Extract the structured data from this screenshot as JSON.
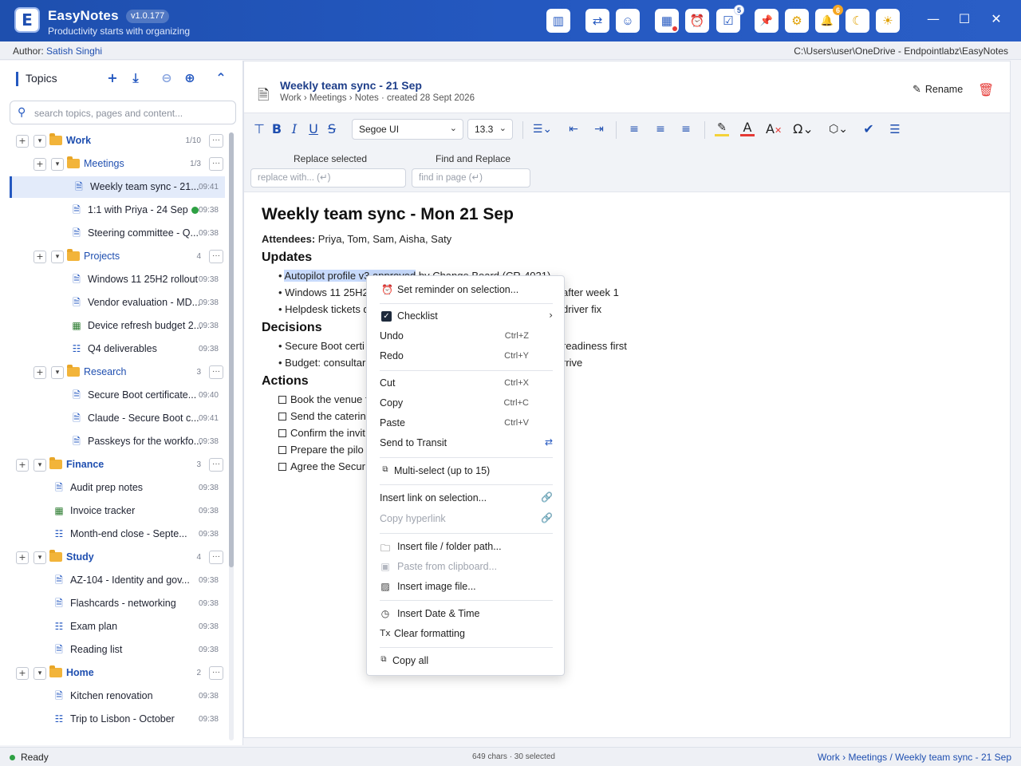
{
  "app": {
    "name": "EasyNotes",
    "version": "v1.0.177",
    "tagline": "Productivity starts with organizing",
    "logo_letter": "E"
  },
  "titlebar_tools": [
    {
      "name": "dashboard-icon",
      "glyph": "▥"
    },
    {
      "name": "transit-icon",
      "glyph": "⇄"
    },
    {
      "name": "robot-icon",
      "glyph": "☺"
    },
    {
      "name": "calendar-icon",
      "glyph": "▦"
    },
    {
      "name": "alarm-clock-icon",
      "glyph": "⏰"
    },
    {
      "name": "tasks-icon",
      "glyph": "☑",
      "badge": "5"
    },
    {
      "name": "pin-icon",
      "glyph": "📌"
    },
    {
      "name": "gear-icon",
      "glyph": "⚙"
    },
    {
      "name": "bell-icon",
      "glyph": "🔔",
      "badge": "6"
    },
    {
      "name": "moon-icon",
      "glyph": "☾"
    },
    {
      "name": "sun-icon",
      "glyph": "☀"
    }
  ],
  "window": {
    "minimize": "—",
    "maximize": "☐",
    "close": "✕"
  },
  "infobar": {
    "author_label": "Author:",
    "author_name": "Satish Singhi",
    "path": "C:\\Users\\user\\OneDrive - Endpointlabz\\EasyNotes"
  },
  "sidebar": {
    "title": "Topics",
    "search_placeholder": "search topics, pages and content...",
    "tree": [
      {
        "type": "folder",
        "level": 0,
        "label": "Work",
        "count": "1/10"
      },
      {
        "type": "folder",
        "level": 1,
        "label": "Meetings",
        "count": "1/3"
      },
      {
        "type": "note",
        "level": 2,
        "label": "Weekly team sync - 21...",
        "time": "09:41",
        "selected": true,
        "icon": "doc"
      },
      {
        "type": "note",
        "level": 2,
        "label": "1:1 with Priya - 24 Sep",
        "time": "09:38",
        "icon": "doc",
        "ok": true
      },
      {
        "type": "note",
        "level": 2,
        "label": "Steering committee - Q...",
        "time": "09:38",
        "icon": "doc"
      },
      {
        "type": "folder",
        "level": 1,
        "label": "Projects",
        "count": "4"
      },
      {
        "type": "note",
        "level": 2,
        "label": "Windows 11 25H2 rollout",
        "time": "09:38",
        "icon": "doc"
      },
      {
        "type": "note",
        "level": 2,
        "label": "Vendor evaluation - MD...",
        "time": "09:38",
        "icon": "doc"
      },
      {
        "type": "note",
        "level": 2,
        "label": "Device refresh budget 2...",
        "time": "09:38",
        "icon": "sheet"
      },
      {
        "type": "note",
        "level": 2,
        "label": "Q4 deliverables",
        "time": "09:38",
        "icon": "list"
      },
      {
        "type": "folder",
        "level": 1,
        "label": "Research",
        "count": "3"
      },
      {
        "type": "note",
        "level": 2,
        "label": "Secure Boot certificate...",
        "time": "09:40",
        "icon": "doc"
      },
      {
        "type": "note",
        "level": 2,
        "label": "Claude - Secure Boot c...",
        "time": "09:41",
        "icon": "doc"
      },
      {
        "type": "note",
        "level": 2,
        "label": "Passkeys for the workfo...",
        "time": "09:38",
        "icon": "doc"
      },
      {
        "type": "folder",
        "level": 0,
        "label": "Finance",
        "count": "3"
      },
      {
        "type": "note",
        "level": 1,
        "label": "Audit prep notes",
        "time": "09:38",
        "icon": "doc"
      },
      {
        "type": "note",
        "level": 1,
        "label": "Invoice tracker",
        "time": "09:38",
        "icon": "sheet"
      },
      {
        "type": "note",
        "level": 1,
        "label": "Month-end close - Septe...",
        "time": "09:38",
        "icon": "list"
      },
      {
        "type": "folder",
        "level": 0,
        "label": "Study",
        "count": "4"
      },
      {
        "type": "note",
        "level": 1,
        "label": "AZ-104 - Identity and gov...",
        "time": "09:38",
        "icon": "doc"
      },
      {
        "type": "note",
        "level": 1,
        "label": "Flashcards - networking",
        "time": "09:38",
        "icon": "doc"
      },
      {
        "type": "note",
        "level": 1,
        "label": "Exam plan",
        "time": "09:38",
        "icon": "list"
      },
      {
        "type": "note",
        "level": 1,
        "label": "Reading list",
        "time": "09:38",
        "icon": "doc"
      },
      {
        "type": "folder",
        "level": 0,
        "label": "Home",
        "count": "2"
      },
      {
        "type": "note",
        "level": 1,
        "label": "Kitchen renovation",
        "time": "09:38",
        "icon": "doc"
      },
      {
        "type": "note",
        "level": 1,
        "label": "Trip to Lisbon - October",
        "time": "09:38",
        "icon": "list"
      }
    ]
  },
  "note": {
    "title": "Weekly team sync - 21 Sep",
    "crumb": "Work › Meetings  ›  Notes  ·  created 28 Sept 2026",
    "rename_label": "Rename"
  },
  "toolbar": {
    "font": "Segoe UI",
    "size": "13.3",
    "replace_selected_label": "Replace selected",
    "replace_placeholder": "replace with... (↵)",
    "find_replace_label": "Find and Replace",
    "find_placeholder": "find in page (↵)"
  },
  "document": {
    "heading": "Weekly team sync - Mon 21 Sep",
    "attendees_label": "Attendees:",
    "attendees": " Priya, Tom, Sam, Aisha, Saty",
    "updates_heading": "Updates",
    "update_1_selected": "Autopilot profile v3 approved",
    "update_1_rest": " by Change Board (CR-4021)",
    "update_2": "Windows 11 25H2 ",
    "update_2_tail": "after week 1",
    "update_3": "Helpdesk tickets d",
    "update_3_tail": "driver fix",
    "decisions_heading": "Decisions",
    "decision_1": "Secure Boot certi",
    "decision_1_tail": "readiness first",
    "decision_2": "Budget: consultar",
    "decision_2_tail": "rrive",
    "actions_heading": "Actions",
    "actions": [
      "Book the venue f",
      "Send the caterin",
      "Confirm the invit",
      "Prepare the pilo",
      "Agree the Secur"
    ]
  },
  "context_menu": {
    "set_reminder": "Set reminder on selection...",
    "checklist": "Checklist",
    "undo": "Undo",
    "undo_sc": "Ctrl+Z",
    "redo": "Redo",
    "redo_sc": "Ctrl+Y",
    "cut": "Cut",
    "cut_sc": "Ctrl+X",
    "copy": "Copy",
    "copy_sc": "Ctrl+C",
    "paste": "Paste",
    "paste_sc": "Ctrl+V",
    "send_transit": "Send to Transit",
    "multi_select": "Multi-select  (up to 15)",
    "insert_link": "Insert link on selection...",
    "copy_hyperlink": "Copy hyperlink",
    "insert_path": "Insert file / folder path...",
    "paste_clipboard": "Paste from clipboard...",
    "insert_image": "Insert image file...",
    "insert_datetime": "Insert Date & Time",
    "clear_formatting": "Clear formatting",
    "clear_formatting_icon": "Tx",
    "copy_all": "Copy all"
  },
  "status": {
    "ready": "Ready",
    "counts": "649 chars · 30 selected",
    "crumb": "Work › Meetings / Weekly team sync - 21 Sep"
  }
}
